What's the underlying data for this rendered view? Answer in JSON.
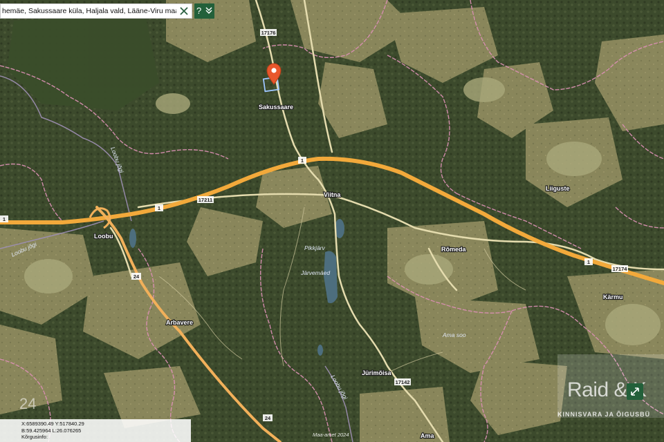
{
  "search": {
    "value": "hemäe, Sakussaare küla, Haljala vald, Lääne-Viru maakond"
  },
  "toolbar": {
    "help_label": "?",
    "collapse_label": "»"
  },
  "places": {
    "sakussaare": "Sakussaare",
    "viitna": "Viitna",
    "liiguste": "Liiguste",
    "loobu": "Loobu",
    "romeda": "Rõmeda",
    "pikkjarv": "Pikkjärv",
    "jarvemaed": "Järvemäed",
    "arbavere": "Arbavere",
    "karmu": "Kärmu",
    "ama_soo": "Ama soo",
    "jurimoisa": "Jürimõisa",
    "ama": "Ama",
    "loobu_jogi_1": "Loobu jõgi",
    "loobu_jogi_2": "Loobu jõgi",
    "loobu_jogi_3": "Loobu jõgi"
  },
  "road_numbers": {
    "r17176": "17176",
    "r1_a": "1",
    "r1_b": "1",
    "r1_c": "1",
    "r1_d": "1",
    "r17211": "17211",
    "r24_a": "24",
    "r24_b": "24",
    "r17174": "17174",
    "r17142": "17142"
  },
  "coords": {
    "x": "X:6589390.49 Y:517840.29",
    "b": "B:59.425964 L:26.076265",
    "height": "Kõrgusinfo:"
  },
  "watermark": {
    "title": "Raid & K",
    "subtitle": "KINNISVARA JA ÕIGUSBÜ"
  },
  "zoom_badge": "24",
  "attribution": "Maa-amet 2024",
  "colors": {
    "highway": "#f2a93b",
    "road": "#e8dfb0",
    "boundary": "#d98fb2",
    "marker": "#e8572c",
    "toolbar": "#23603a"
  }
}
